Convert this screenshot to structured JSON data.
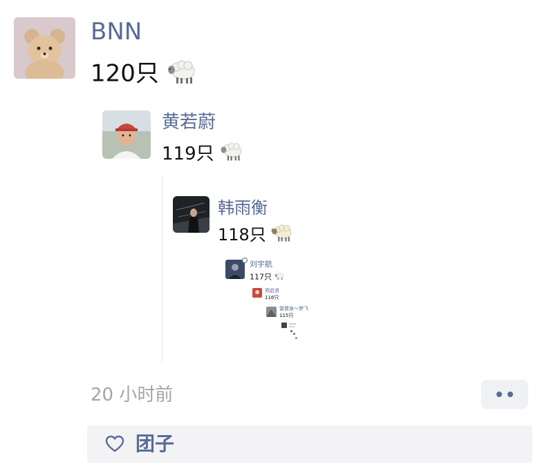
{
  "post": {
    "author": "BNN",
    "text": "120只",
    "sheep_icon": "sheep-emoji"
  },
  "replies": [
    {
      "author": "黄若蔚",
      "text": "119只"
    },
    {
      "author": "韩雨衡",
      "text": "118只"
    },
    {
      "author": "刘宇航",
      "text": "117只"
    },
    {
      "author": "郑启贤",
      "text": "116只"
    },
    {
      "author": "雷健身～梦飞",
      "text": "115只"
    }
  ],
  "footer": {
    "time": "20 小时前",
    "more_icon": "more-dots-icon",
    "likes_icon": "heart-icon",
    "likes_names": "团子"
  },
  "colors": {
    "name": "#576b95",
    "time": "#a4a4a4",
    "bar_bg": "#f3f3f5"
  }
}
